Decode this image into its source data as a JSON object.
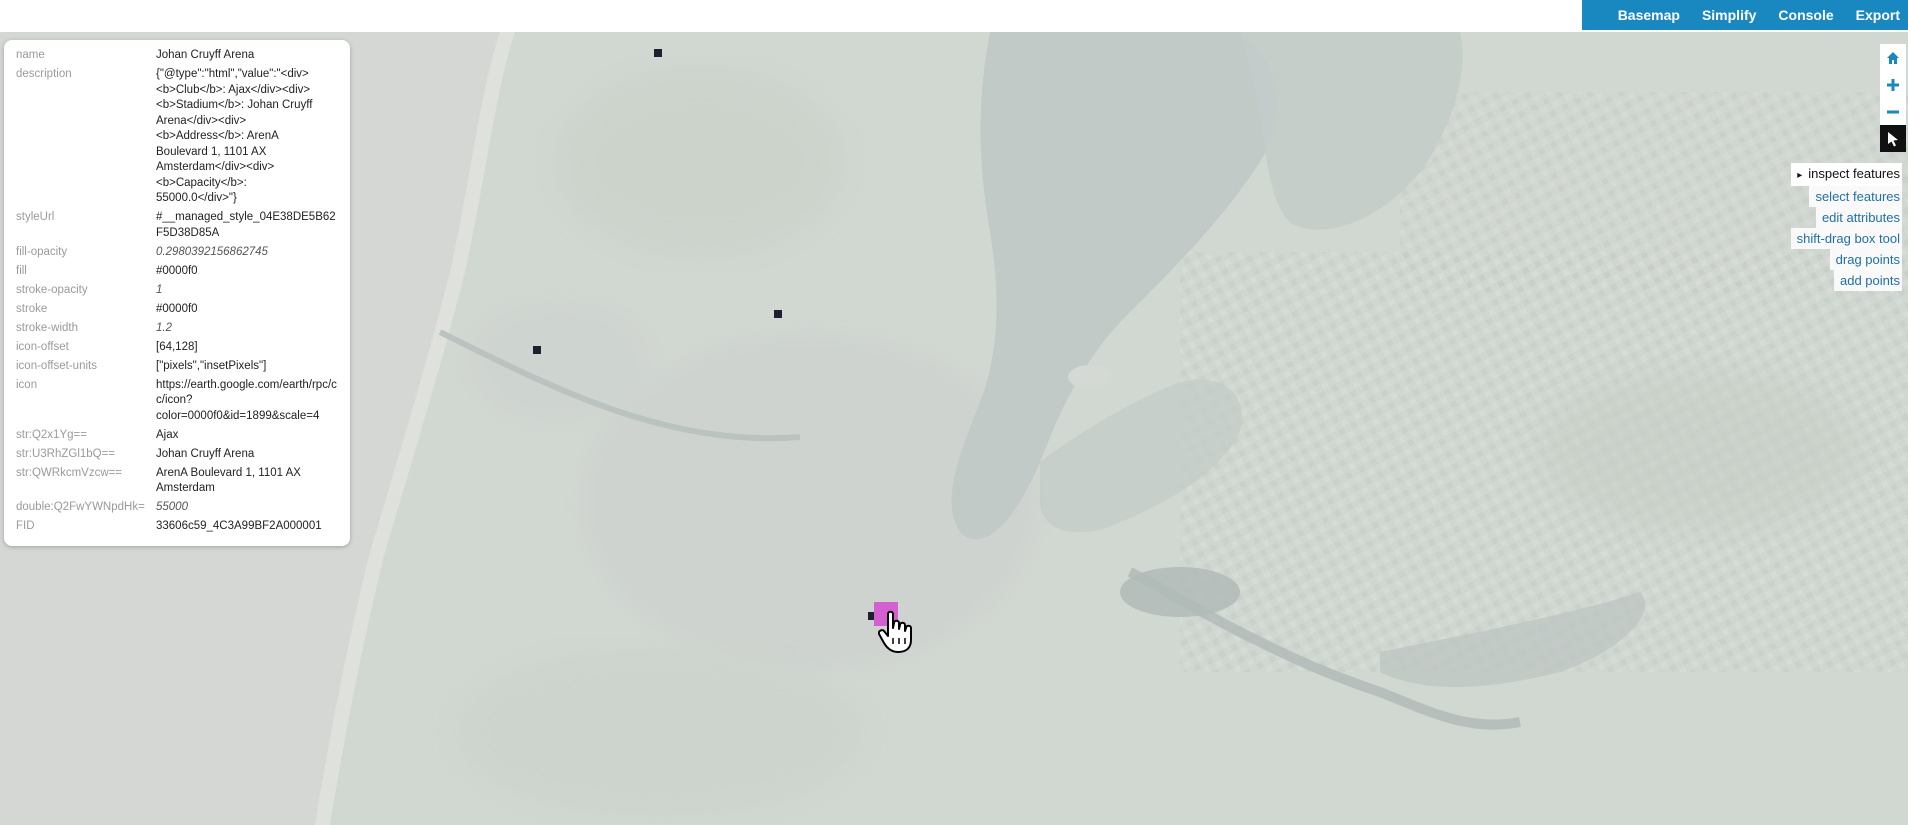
{
  "menu": {
    "items": [
      {
        "label": "Basemap"
      },
      {
        "label": "Simplify"
      },
      {
        "label": "Console"
      },
      {
        "label": "Export"
      }
    ]
  },
  "colors": {
    "menu_bg": "#1a88c0",
    "highlight": "#d35fd0",
    "point": "#1f1f30"
  },
  "map_controls": [
    {
      "icon": "home-icon"
    },
    {
      "icon": "zoom-in-icon"
    },
    {
      "icon": "zoom-out-icon"
    },
    {
      "icon": "pointer-icon",
      "active": true
    }
  ],
  "tools": [
    {
      "label": "inspect features",
      "active": true
    },
    {
      "label": "select features"
    },
    {
      "label": "edit attributes"
    },
    {
      "label": "shift-drag box tool"
    },
    {
      "label": "drag points"
    },
    {
      "label": "add points"
    }
  ],
  "popup": {
    "rows": [
      {
        "key": "name",
        "value": "Johan Cruyff Arena"
      },
      {
        "key": "description",
        "value": "{\"@type\":\"html\",\"value\":\"<div>\n<b>Club</b>: Ajax</div><div>\n<b>Stadium</b>: Johan Cruyff\nArena</div><div>\n<b>Address</b>: ArenA\nBoulevard 1, 1101 AX\nAmsterdam</div><div>\n<b>Capacity</b>:\n55000.0</div>\"}"
      },
      {
        "key": "styleUrl",
        "value": "#__managed_style_04E38DE5B62F5D38D85A"
      },
      {
        "key": "fill-opacity",
        "value": "0.2980392156862745",
        "numeric": true
      },
      {
        "key": "fill",
        "value": "#0000f0"
      },
      {
        "key": "stroke-opacity",
        "value": "1",
        "numeric": true
      },
      {
        "key": "stroke",
        "value": "#0000f0"
      },
      {
        "key": "stroke-width",
        "value": "1.2",
        "numeric": true
      },
      {
        "key": "icon-offset",
        "value": "[64,128]"
      },
      {
        "key": "icon-offset-units",
        "value": "[\"pixels\",\"insetPixels\"]"
      },
      {
        "key": "icon",
        "value": "https://earth.google.com/earth/rpc/cc/icon?\ncolor=0000f0&id=1899&scale=4"
      },
      {
        "key": "str:Q2x1Yg==",
        "value": "Ajax"
      },
      {
        "key": "str:U3RhZGl1bQ==",
        "value": "Johan Cruyff Arena"
      },
      {
        "key": "str:QWRkcmVzcw==",
        "value": "ArenA Boulevard 1, 1101 AX\nAmsterdam"
      },
      {
        "key": "double:Q2FwYWNpdHk=",
        "value": "55000",
        "numeric": true
      },
      {
        "key": "FID",
        "value": "33606c59_4C3A99BF2A000001"
      }
    ]
  }
}
